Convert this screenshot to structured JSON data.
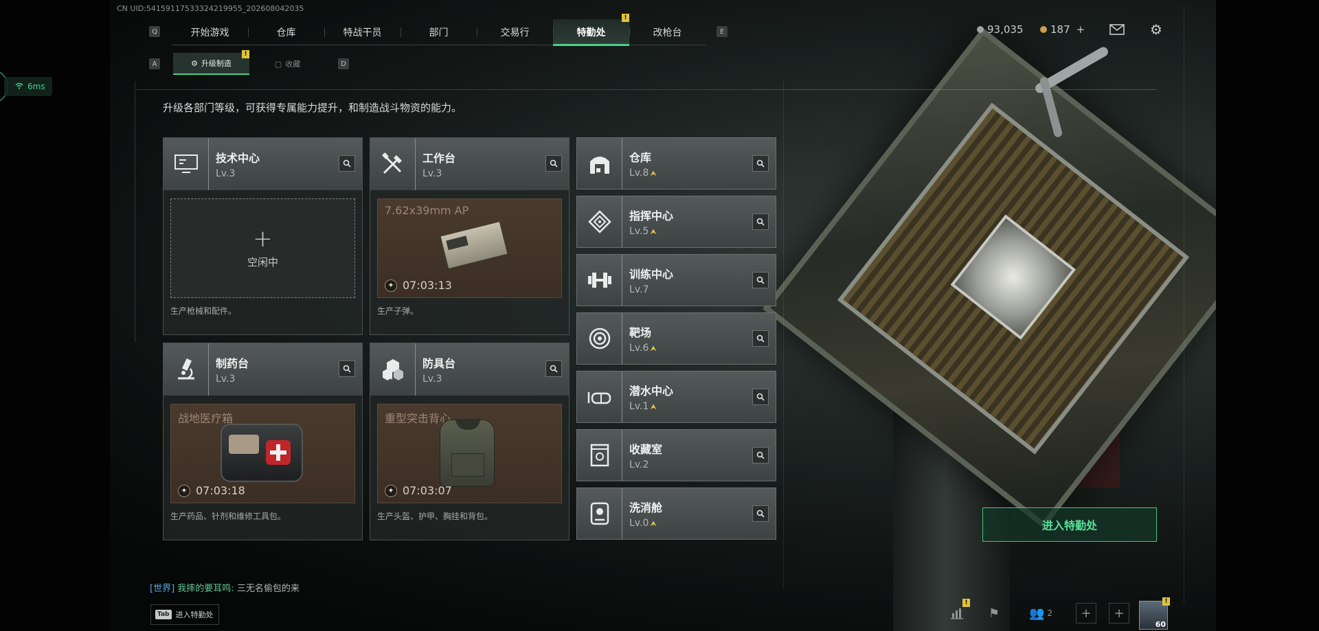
{
  "meta": {
    "uid": "CN UID:54159117533324219955_202608042035",
    "ping": "6ms"
  },
  "nav": {
    "key_left": "Q",
    "key_right": "E",
    "tabs": [
      "开始游戏",
      "仓库",
      "特战干员",
      "部门",
      "交易行",
      "特勤处",
      "改枪台"
    ],
    "active_tab": "特勤处",
    "alert": "!"
  },
  "subnav": {
    "key_left": "A",
    "key_right": "D",
    "tabs": [
      "升级制造",
      "收藏"
    ],
    "active_tab": "升级制造",
    "alert": "!"
  },
  "currency": {
    "silver": "93,035",
    "gold": "187",
    "add": "+"
  },
  "icons": {
    "mail": "mail-icon",
    "settings": "gear-icon"
  },
  "description": "升级各部门等级，可获得专属能力提升，和制造战斗物资的能力。",
  "workshops": [
    {
      "name": "技术中心",
      "level": "Lv.3",
      "icon": "computer-icon",
      "slot": {
        "state": "idle",
        "idle_label": "空闲中"
      },
      "footer": "生产枪械和配件。"
    },
    {
      "name": "工作台",
      "level": "Lv.3",
      "icon": "tools-icon",
      "slot": {
        "state": "busy",
        "item": "7.62x39mm AP",
        "timer": "07:03:13"
      },
      "footer": "生产子弹。"
    },
    {
      "name": "制药台",
      "level": "Lv.3",
      "icon": "microscope-icon",
      "slot": {
        "state": "busy",
        "item": "战地医疗箱",
        "timer": "07:03:18"
      },
      "footer": "生产药品、针剂和维修工具包。"
    },
    {
      "name": "防具台",
      "level": "Lv.3",
      "icon": "cubes-icon",
      "slot": {
        "state": "busy",
        "item": "重型突击背心",
        "timer": "07:03:07"
      },
      "footer": "生产头盔、护甲、胸挂和背包。"
    }
  ],
  "facilities": [
    {
      "name": "仓库",
      "level": "Lv.8",
      "upgradable": true,
      "icon": "warehouse-icon"
    },
    {
      "name": "指挥中心",
      "level": "Lv.5",
      "upgradable": true,
      "icon": "command-icon"
    },
    {
      "name": "训练中心",
      "level": "Lv.7",
      "upgradable": false,
      "icon": "dumbbell-icon"
    },
    {
      "name": "靶场",
      "level": "Lv.6",
      "upgradable": true,
      "icon": "target-icon"
    },
    {
      "name": "潜水中心",
      "level": "Lv.1",
      "upgradable": true,
      "icon": "diving-mask-icon"
    },
    {
      "name": "收藏室",
      "level": "Lv.2",
      "upgradable": false,
      "icon": "collection-icon"
    },
    {
      "name": "洗消舱",
      "level": "Lv.0",
      "upgradable": true,
      "icon": "decon-icon"
    }
  ],
  "enter_button": "进入特勤处",
  "chat": {
    "channel": "[世界]",
    "sender": "我摔的要耳鸣:",
    "message": "三无名偷包的来"
  },
  "tab_hint": {
    "key": "Tab",
    "label": "进入特勤处"
  },
  "bottom_bar": {
    "alert": "!",
    "friends": "2",
    "player_level": "60"
  },
  "colors": {
    "accent": "#49d28c",
    "alert": "#e0c33a",
    "upgrade": "#e5c34c",
    "card_head": "#4a504f",
    "slot_busy": "#43352a"
  }
}
